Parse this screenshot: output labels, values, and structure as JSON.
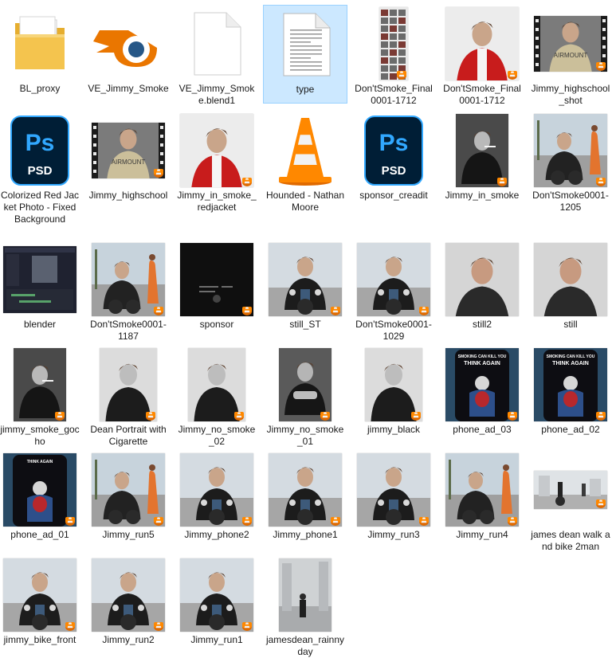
{
  "window": {
    "view": "Large icons"
  },
  "files": [
    {
      "name": "BL_proxy",
      "kind": "folder",
      "icon": "folder-icon",
      "art": "folder"
    },
    {
      "name": "VE_Jimmy_Smoke",
      "kind": "blender",
      "icon": "blender-icon",
      "art": "blender"
    },
    {
      "name": "VE_Jimmy_Smoke.blend1",
      "kind": "file",
      "icon": "blank-file-icon",
      "art": "blank"
    },
    {
      "name": "type",
      "kind": "text",
      "icon": "text-file-icon",
      "art": "text",
      "selected": true
    },
    {
      "name": "Don'tSmoke_Final0001-1712",
      "kind": "video",
      "icon": "video-thumb",
      "art": "contact"
    },
    {
      "name": "Don'tSmoke_Final0001-1712",
      "kind": "video",
      "icon": "video-thumb",
      "art": "redjacket"
    },
    {
      "name": "Jimmy_highschool_shot",
      "kind": "video",
      "icon": "video-thumb",
      "art": "jacket",
      "film": true
    },
    {
      "name": "Colorized Red Jacket Photo - Fixed Background",
      "kind": "psd",
      "icon": "photoshop-icon",
      "art": "psd"
    },
    {
      "name": "Jimmy_highschool",
      "kind": "video",
      "icon": "video-thumb",
      "art": "jacket",
      "film": true
    },
    {
      "name": "Jimmy_in_smoke_redjacket",
      "kind": "video",
      "icon": "video-thumb",
      "art": "redjacket"
    },
    {
      "name": "Hounded - Nathan Moore",
      "kind": "audio",
      "icon": "vlc-cone-icon",
      "art": "vlc"
    },
    {
      "name": "sponsor_creadit",
      "kind": "psd",
      "icon": "photoshop-icon",
      "art": "psd"
    },
    {
      "name": "Jimmy_in_smoke",
      "kind": "video",
      "icon": "video-thumb",
      "art": "bwsmoke"
    },
    {
      "name": "Don'tSmoke0001-1205",
      "kind": "video",
      "icon": "video-thumb",
      "art": "bikewoman"
    },
    {
      "name": "blender",
      "kind": "video",
      "icon": "video-thumb",
      "art": "screen"
    },
    {
      "name": "Don'tSmoke0001-1187",
      "kind": "video",
      "icon": "video-thumb",
      "art": "bikewoman"
    },
    {
      "name": "sponsor",
      "kind": "video",
      "icon": "video-thumb",
      "art": "dark"
    },
    {
      "name": "still_ST",
      "kind": "image",
      "icon": "image-thumb",
      "art": "bike"
    },
    {
      "name": "Don'tSmoke0001-1029",
      "kind": "video",
      "icon": "video-thumb",
      "art": "bike"
    },
    {
      "name": "still2",
      "kind": "image",
      "icon": "image-thumb",
      "art": "portrait"
    },
    {
      "name": "still",
      "kind": "image",
      "icon": "image-thumb",
      "art": "portrait"
    },
    {
      "name": "jimmy_smoke_gocho",
      "kind": "video",
      "icon": "video-thumb",
      "art": "bwsmoke"
    },
    {
      "name": "Dean Portrait with Cigarette",
      "kind": "image",
      "icon": "image-thumb",
      "art": "bwportrait"
    },
    {
      "name": "Jimmy_no_smoke_02",
      "kind": "video",
      "icon": "video-thumb",
      "art": "bwportrait"
    },
    {
      "name": "Jimmy_no_smoke_01",
      "kind": "video",
      "icon": "video-thumb",
      "art": "bwbreak"
    },
    {
      "name": "jimmy_black",
      "kind": "image",
      "icon": "image-thumb",
      "art": "bwportrait"
    },
    {
      "name": "phone_ad_03",
      "kind": "video",
      "icon": "video-thumb",
      "art": "phone",
      "caption": "SMOKING CAN KILL YOU\nTHINK AGAIN"
    },
    {
      "name": "phone_ad_02",
      "kind": "video",
      "icon": "video-thumb",
      "art": "phone",
      "caption": "SMOKING CAN KILL YOU\nTHINK AGAIN"
    },
    {
      "name": "phone_ad_01",
      "kind": "video",
      "icon": "video-thumb",
      "art": "phone2",
      "caption": "THINK AGAIN"
    },
    {
      "name": "Jimmy_run5",
      "kind": "video",
      "icon": "video-thumb",
      "art": "bikewoman"
    },
    {
      "name": "Jimmy_phone2",
      "kind": "video",
      "icon": "video-thumb",
      "art": "bike"
    },
    {
      "name": "Jimmy_phone1",
      "kind": "video",
      "icon": "video-thumb",
      "art": "bike"
    },
    {
      "name": "Jimmy_run3",
      "kind": "video",
      "icon": "video-thumb",
      "art": "bike"
    },
    {
      "name": "Jimmy_run4",
      "kind": "video",
      "icon": "video-thumb",
      "art": "bikewoman"
    },
    {
      "name": "james dean walk and bike 2man",
      "kind": "image",
      "icon": "image-thumb",
      "art": "street"
    },
    {
      "name": "jimmy_bike_front",
      "kind": "video",
      "icon": "video-thumb",
      "art": "bike"
    },
    {
      "name": "Jimmy_run2",
      "kind": "video",
      "icon": "video-thumb",
      "art": "bike"
    },
    {
      "name": "Jimmy_run1",
      "kind": "video",
      "icon": "video-thumb",
      "art": "bike"
    },
    {
      "name": "jamesdean_rainnyday",
      "kind": "image",
      "icon": "image-thumb",
      "art": "rain"
    }
  ],
  "colors": {
    "selection_bg": "#cce8ff",
    "selection_border": "#99d1ff",
    "psd_bg": "#001e36",
    "psd_accent": "#31a8ff",
    "vlc_orange": "#ff8800",
    "blender_orange": "#ea7600",
    "blender_blue": "#265787",
    "folder_yellow": "#f4c44e"
  }
}
